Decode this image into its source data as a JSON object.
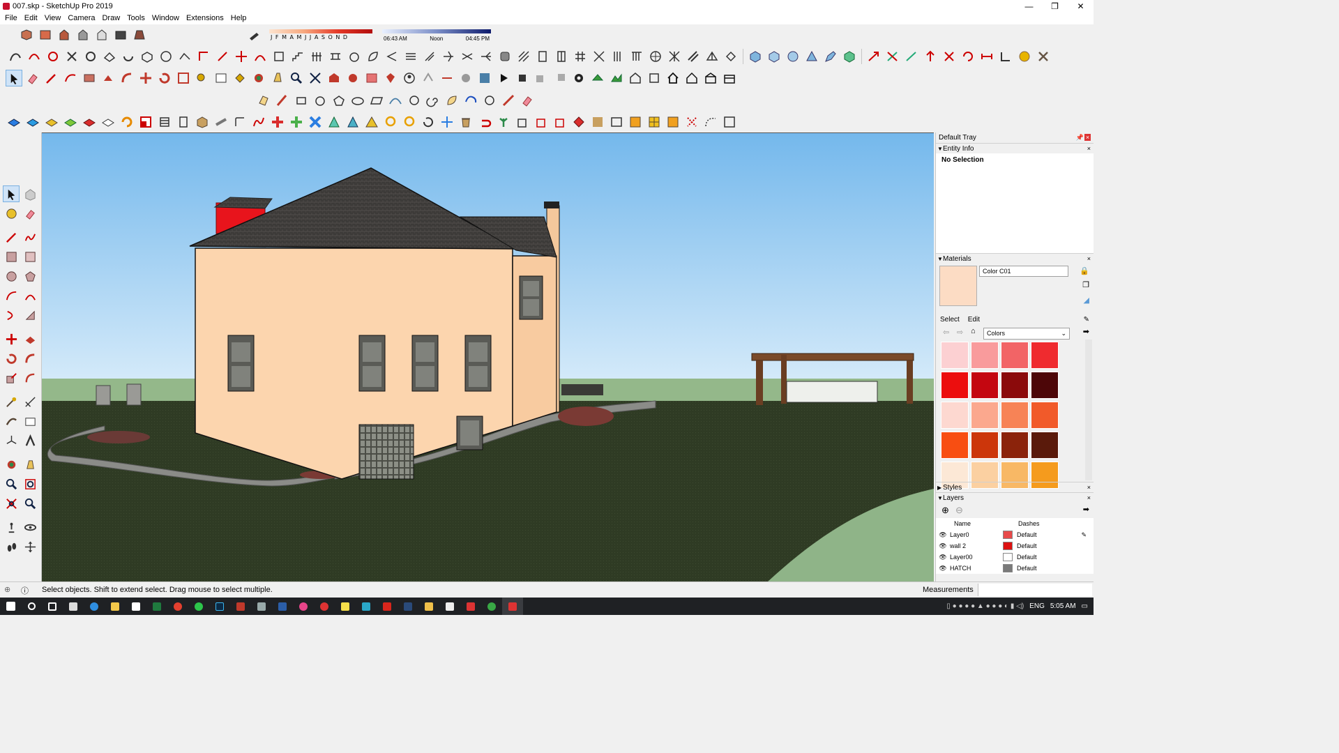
{
  "window": {
    "title": "007.skp - SketchUp Pro 2019",
    "minimize": "—",
    "maximize": "❐",
    "close": "✕"
  },
  "menu": [
    "File",
    "Edit",
    "View",
    "Camera",
    "Draw",
    "Tools",
    "Window",
    "Extensions",
    "Help"
  ],
  "shadows": {
    "months": [
      "J",
      "F",
      "M",
      "A",
      "M",
      "J",
      "J",
      "A",
      "S",
      "O",
      "N",
      "D"
    ],
    "time_start": "06:43 AM",
    "time_mid": "Noon",
    "time_end": "04:45 PM"
  },
  "tray": {
    "title": "Default Tray",
    "entity_info": {
      "header": "Entity Info",
      "body": "No Selection"
    },
    "materials": {
      "header": "Materials",
      "name": "Color C01",
      "swatch_color": "#fcdcc4",
      "tab_select": "Select",
      "tab_edit": "Edit",
      "library": "Colors",
      "swatches": [
        "#fcd0d2",
        "#f99b9c",
        "#f26466",
        "#ef2b2f",
        "#ec0e0e",
        "#c40610",
        "#8b0a0b",
        "#4d0608",
        "#fdd8d0",
        "#fba88e",
        "#f78356",
        "#f15a2a",
        "#f84e12",
        "#cc360b",
        "#8b230b",
        "#5a1a0b",
        "#fce8d6",
        "#fbd0a1",
        "#f8b865",
        "#f59b1d"
      ]
    },
    "styles": {
      "header": "Styles"
    },
    "layers": {
      "header": "Layers",
      "col_name": "Name",
      "col_dashes": "Dashes",
      "rows": [
        {
          "name": "Layer0",
          "color": "#e74a4a",
          "dashes": "Default"
        },
        {
          "name": "wall 2",
          "color": "#dd1111",
          "dashes": "Default"
        },
        {
          "name": "Layer00",
          "color": "#ffffff",
          "dashes": "Default"
        },
        {
          "name": "HATCH",
          "color": "#7a7a7a",
          "dashes": "Default"
        }
      ]
    }
  },
  "status": {
    "hint": "Select objects. Shift to extend select. Drag mouse to select multiple.",
    "measurements_label": "Measurements"
  },
  "taskbar": {
    "lang": "ENG",
    "time": "5:05 AM"
  },
  "colors": {
    "sky": "#87c4ee",
    "lawn": "#2f3b24",
    "wall": "#fcd5ae",
    "roof": "#3c3a38"
  }
}
